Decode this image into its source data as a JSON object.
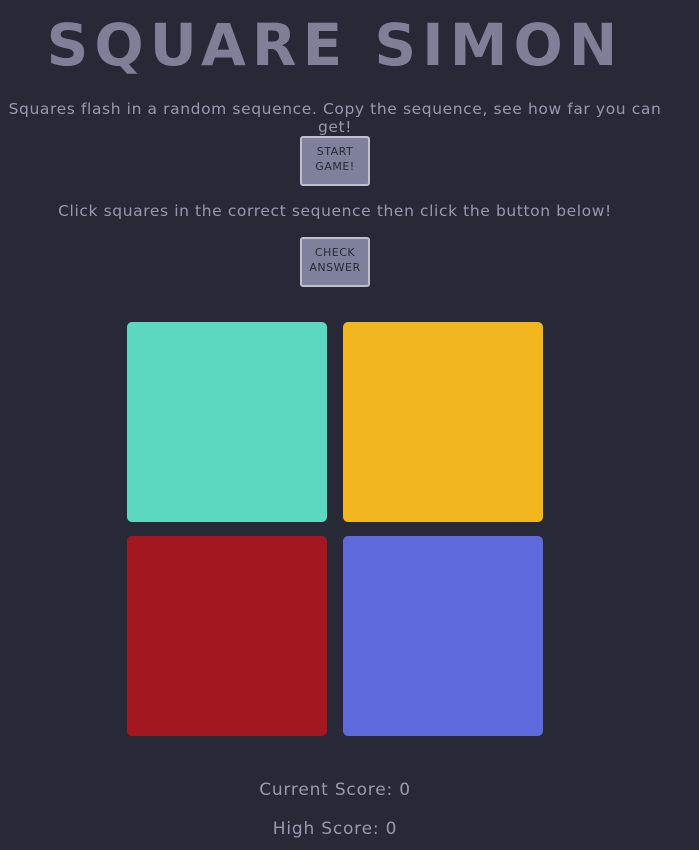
{
  "title": "SQUARE SIMON",
  "intro_text": "Squares flash in a random sequence. Copy the sequence, see how far you can get!",
  "start_button": {
    "line1": "START",
    "line2": "GAME!"
  },
  "instructions_text": "Click squares in the correct sequence then click the button below!",
  "check_button": {
    "line1": "CHECK",
    "line2": "ANSWER"
  },
  "squares": [
    {
      "name": "teal",
      "color": "#5cd8c1"
    },
    {
      "name": "yellow",
      "color": "#f2b620"
    },
    {
      "name": "red",
      "color": "#a21720"
    },
    {
      "name": "blue",
      "color": "#5e69dc"
    }
  ],
  "scores": {
    "current_label": "Current Score: ",
    "current_value": "0",
    "high_label": "High Score: ",
    "high_value": "0"
  },
  "colors": {
    "background": "#272936",
    "text": "#9899ad",
    "button_bg": "#7f809c"
  }
}
